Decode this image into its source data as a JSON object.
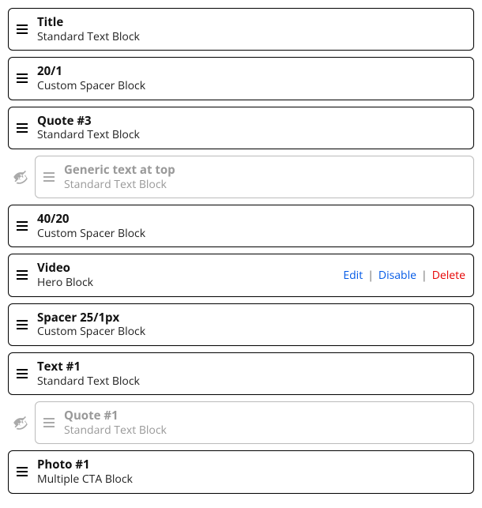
{
  "actions": {
    "edit": "Edit",
    "disable": "Disable",
    "delete": "Delete"
  },
  "blocks": [
    {
      "title": "Title",
      "subtitle": "Standard Text Block",
      "disabled": false,
      "showActions": false
    },
    {
      "title": "20/1",
      "subtitle": "Custom Spacer Block",
      "disabled": false,
      "showActions": false
    },
    {
      "title": "Quote #3",
      "subtitle": "Standard Text Block",
      "disabled": false,
      "showActions": false
    },
    {
      "title": "Generic text at top",
      "subtitle": "Standard Text Block",
      "disabled": true,
      "showActions": false
    },
    {
      "title": "40/20",
      "subtitle": "Custom Spacer Block",
      "disabled": false,
      "showActions": false
    },
    {
      "title": "Video",
      "subtitle": "Hero Block",
      "disabled": false,
      "showActions": true
    },
    {
      "title": "Spacer 25/1px",
      "subtitle": "Custom Spacer Block",
      "disabled": false,
      "showActions": false
    },
    {
      "title": "Text #1",
      "subtitle": "Standard Text Block",
      "disabled": false,
      "showActions": false
    },
    {
      "title": "Quote #1",
      "subtitle": "Standard Text Block",
      "disabled": true,
      "showActions": false
    },
    {
      "title": "Photo #1",
      "subtitle": "Multiple CTA Block",
      "disabled": false,
      "showActions": false
    }
  ]
}
